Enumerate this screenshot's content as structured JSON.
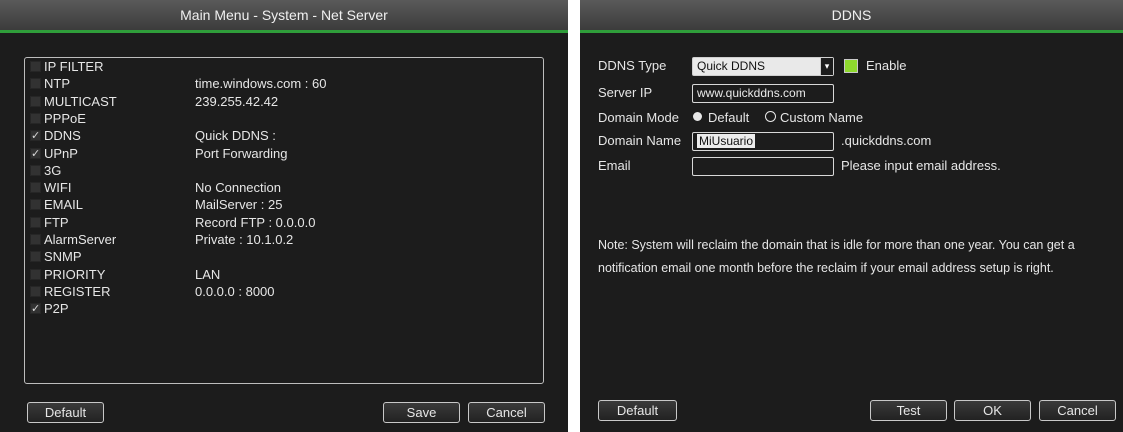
{
  "net_server": {
    "title": "Main Menu - System - Net Server",
    "items": [
      {
        "name": "IP FILTER",
        "checked": false,
        "value": ""
      },
      {
        "name": "NTP",
        "checked": false,
        "value": "time.windows.com : 60"
      },
      {
        "name": "MULTICAST",
        "checked": false,
        "value": "239.255.42.42"
      },
      {
        "name": "PPPoE",
        "checked": false,
        "value": ""
      },
      {
        "name": "DDNS",
        "checked": true,
        "value": "Quick DDNS :"
      },
      {
        "name": "UPnP",
        "checked": true,
        "value": "Port Forwarding"
      },
      {
        "name": "3G",
        "checked": false,
        "value": ""
      },
      {
        "name": "WIFI",
        "checked": false,
        "value": "No Connection"
      },
      {
        "name": "EMAIL",
        "checked": false,
        "value": "MailServer : 25"
      },
      {
        "name": "FTP",
        "checked": false,
        "value": "Record FTP : 0.0.0.0"
      },
      {
        "name": "AlarmServer",
        "checked": false,
        "value": "Private : 10.1.0.2"
      },
      {
        "name": "SNMP",
        "checked": false,
        "value": ""
      },
      {
        "name": "PRIORITY",
        "checked": false,
        "value": "LAN"
      },
      {
        "name": "REGISTER",
        "checked": false,
        "value": "0.0.0.0 : 8000"
      },
      {
        "name": "P2P",
        "checked": true,
        "value": ""
      }
    ],
    "buttons": {
      "default": "Default",
      "save": "Save",
      "cancel": "Cancel"
    }
  },
  "ddns": {
    "title": "DDNS",
    "type_label": "DDNS Type",
    "type_value": "Quick DDNS",
    "enable_label": "Enable",
    "enable_checked": true,
    "server_ip_label": "Server IP",
    "server_ip_value": "www.quickddns.com",
    "domain_mode_label": "Domain Mode",
    "mode_default": "Default",
    "mode_custom": "Custom Name",
    "domain_name_label": "Domain Name",
    "domain_name_value": "MiUsuario",
    "domain_suffix": ".quickddns.com",
    "email_label": "Email",
    "email_value": "",
    "email_hint": "Please input email address.",
    "note_line1": "Note: System will reclaim the domain that is idle for more than one year. You can get a",
    "note_line2": "notification email one month before the reclaim if your email address setup is right.",
    "buttons": {
      "default": "Default",
      "test": "Test",
      "ok": "OK",
      "cancel": "Cancel"
    },
    "accent_color": "#2f9d3a",
    "enable_color": "#8fd92e"
  }
}
